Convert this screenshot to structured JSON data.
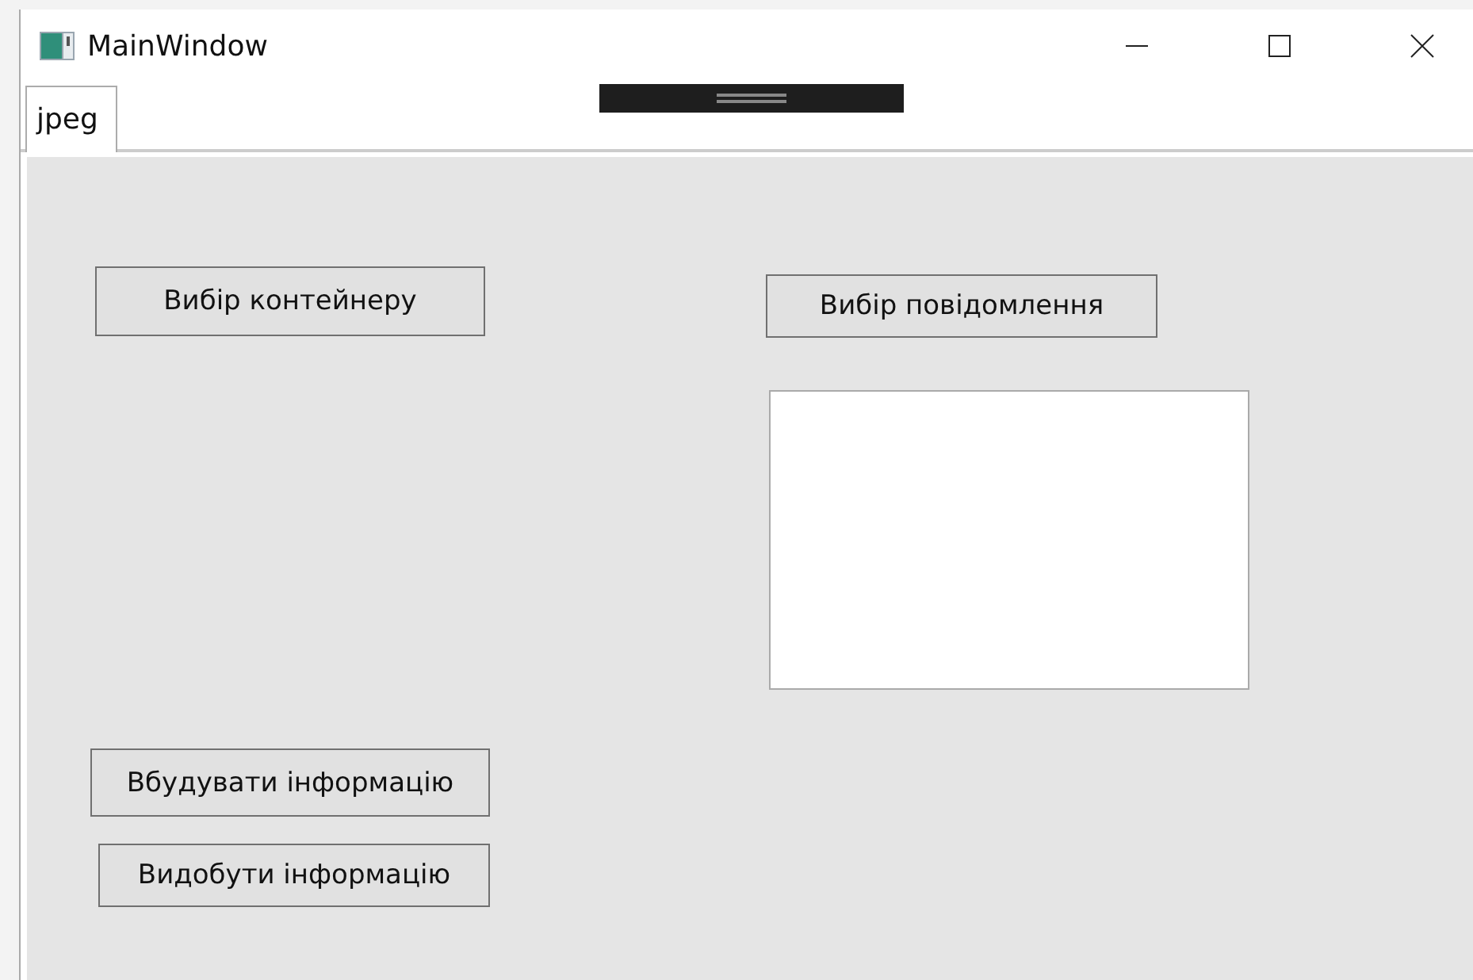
{
  "window": {
    "title": "MainWindow"
  },
  "tabs": [
    {
      "label": "jpeg",
      "selected": true
    }
  ],
  "left_buttons": [
    {
      "label": "Вибір контейнеру"
    },
    {
      "label": "Вбудувати інформацію"
    },
    {
      "label": "Видобути інформацію"
    }
  ],
  "message_button": {
    "label": "Вибір повідомлення"
  }
}
